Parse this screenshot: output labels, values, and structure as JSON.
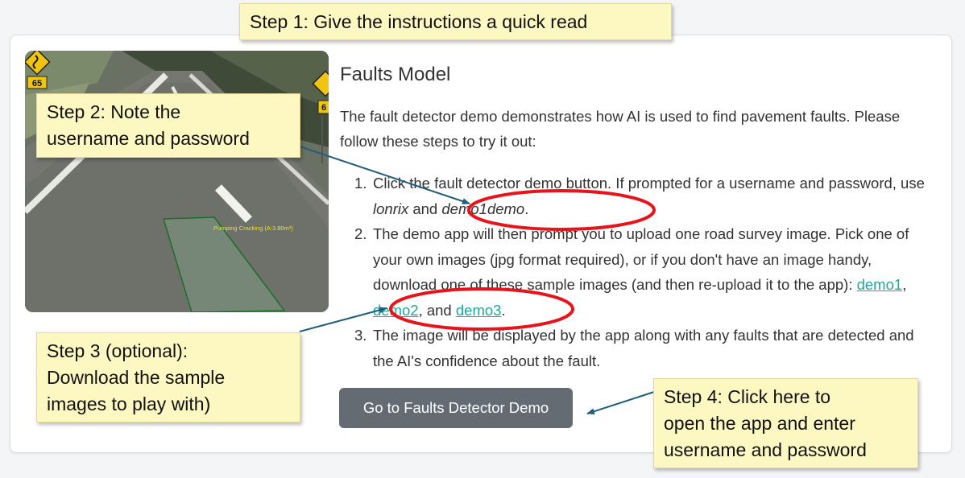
{
  "callouts": {
    "step1": "Step 1: Give the instructions a quick read",
    "step2": [
      "Step 2: Note the",
      "username and password"
    ],
    "step3": [
      "Step 3 (optional):",
      "Download the sample",
      "images to play with)"
    ],
    "step4": [
      "Step 4: Click here to",
      "open the app and enter",
      "username and password"
    ]
  },
  "image": {
    "sign_speed": "65",
    "sign_speed_right": "6",
    "detection_label": "Pumping Cracking (A:3.80m²)"
  },
  "model": {
    "title": "Faults Model",
    "intro": "The fault detector demo demonstrates how AI is used to find pavement faults. Please follow these steps to try it out:",
    "steps": {
      "s1": {
        "num": "1.",
        "text_a": "Click the fault detector demo button. If prompted for a username and password, use ",
        "username": "lonrix",
        "and": " and ",
        "password": "demo1demo",
        "end": "."
      },
      "s2": {
        "num": "2.",
        "text": "The demo app will then prompt you to upload one road survey image. Pick one of your own images (jpg format required), or if you don't have an image handy, download one of these sample images (and then re-upload it to the app): ",
        "link1": "demo1",
        "sep1": ", ",
        "link2": "demo2",
        "sep2": ", and ",
        "link3": "demo3",
        "end": "."
      },
      "s3": {
        "num": "3.",
        "text": "The image will be displayed by the app along with any faults that are detected and the AI's confidence about the fault."
      }
    },
    "button_label": "Go to Faults Detector Demo"
  },
  "colors": {
    "callout_bg": "#fdf8c2",
    "annotation_red": "#e8141b",
    "arrow_teal": "#1f5f7a",
    "link_teal": "#1aa99b",
    "button_gray": "#656b73"
  }
}
